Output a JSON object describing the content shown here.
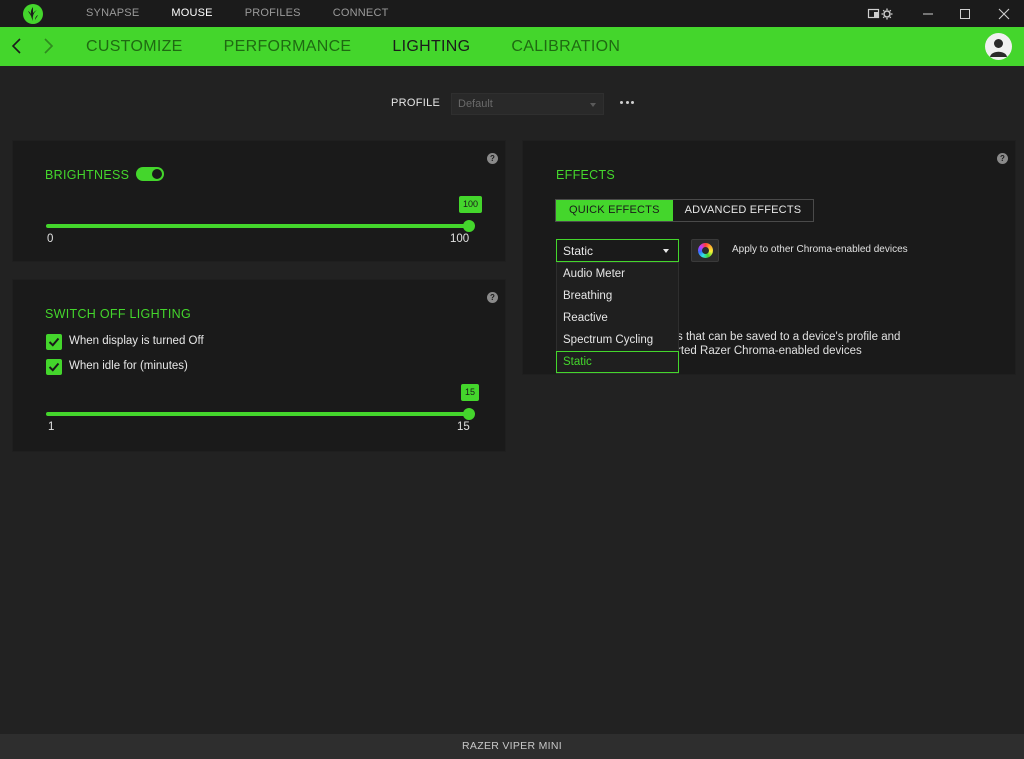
{
  "app": {
    "top_nav": [
      "SYNAPSE",
      "MOUSE",
      "PROFILES",
      "CONNECT"
    ],
    "active_top_nav": "MOUSE"
  },
  "sub_nav": {
    "items": [
      "CUSTOMIZE",
      "PERFORMANCE",
      "LIGHTING",
      "CALIBRATION"
    ],
    "active": "LIGHTING"
  },
  "profile": {
    "label": "PROFILE",
    "value": "Default"
  },
  "brightness": {
    "title": "BRIGHTNESS",
    "enabled": true,
    "value": "100",
    "min_label": "0",
    "max_label": "100",
    "level": 100
  },
  "switch_off": {
    "title": "SWITCH OFF LIGHTING",
    "options": [
      {
        "label": "When display is turned Off",
        "checked": true
      },
      {
        "label": "When idle for (minutes)",
        "checked": true
      }
    ],
    "idle_value": "15",
    "min_label": "1",
    "max_label": "15",
    "level": 15
  },
  "effects": {
    "title": "EFFECTS",
    "tabs": [
      "QUICK EFFECTS",
      "ADVANCED EFFECTS"
    ],
    "active_tab": "QUICK EFFECTS",
    "selected": "Static",
    "apply_label": "Apply to other Chroma-enabled devices",
    "description_line1": "s that can be saved to a device's profile and",
    "description_line2": "rted Razer Chroma-enabled devices",
    "options": [
      "Audio Meter",
      "Breathing",
      "Reactive",
      "Spectrum Cycling",
      "Static"
    ]
  },
  "footer": {
    "device_name": "RAZER VIPER MINI"
  },
  "colors": {
    "accent": "#44d62c",
    "background": "#222222",
    "panel": "#1a1a1a",
    "titlebar": "#1b1b1b"
  },
  "icons": [
    "razer-logo-icon",
    "back-arrow-icon",
    "forward-arrow-icon",
    "user-avatar-icon",
    "help-icon",
    "more-dots-icon",
    "chroma-wheel-icon",
    "checkmark-icon",
    "minimize-icon",
    "maximize-icon",
    "close-icon",
    "device-settings-icon"
  ]
}
